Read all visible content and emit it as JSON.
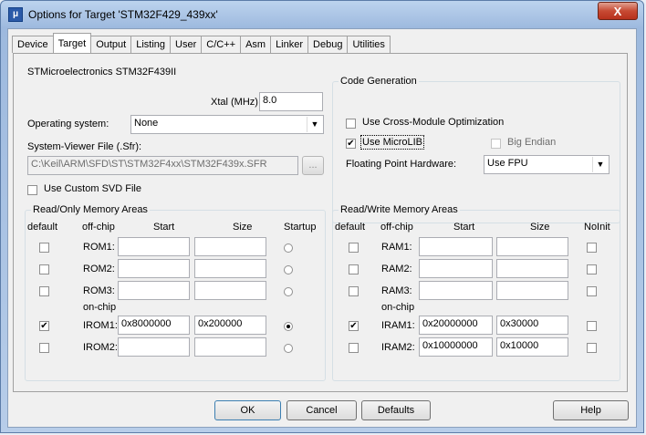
{
  "window": {
    "title": "Options for Target 'STM32F429_439xx'",
    "close_label": "X"
  },
  "tabs": [
    "Device",
    "Target",
    "Output",
    "Listing",
    "User",
    "C/C++",
    "Asm",
    "Linker",
    "Debug",
    "Utilities"
  ],
  "target": {
    "device_name": "STMicroelectronics STM32F439II",
    "xtal_label": "Xtal (MHz):",
    "xtal_value": "8.0",
    "os_label": "Operating system:",
    "os_value": "None",
    "svd_label": "System-Viewer File (.Sfr):",
    "svd_value": "C:\\Keil\\ARM\\SFD\\ST\\STM32F4xx\\STM32F439x.SFR",
    "browse_label": "...",
    "custom_svd_label": "Use Custom SVD File"
  },
  "code_generation": {
    "title": "Code Generation",
    "cross_module_label": "Use Cross-Module Optimization",
    "microlib_label": "Use MicroLIB",
    "microlib_checked": true,
    "big_endian_label": "Big Endian",
    "fpu_label": "Floating Point Hardware:",
    "fpu_value": "Use FPU"
  },
  "rom": {
    "title": "Read/Only Memory Areas",
    "headers": {
      "default": "default",
      "offchip": "off-chip",
      "start": "Start",
      "size": "Size",
      "extra": "Startup"
    },
    "onchip_label": "on-chip",
    "rows": [
      {
        "label": "ROM1:",
        "start": "",
        "size": "",
        "checked": false,
        "startup": false
      },
      {
        "label": "ROM2:",
        "start": "",
        "size": "",
        "checked": false,
        "startup": false
      },
      {
        "label": "ROM3:",
        "start": "",
        "size": "",
        "checked": false,
        "startup": false
      },
      {
        "label": "IROM1:",
        "start": "0x8000000",
        "size": "0x200000",
        "checked": true,
        "startup": true
      },
      {
        "label": "IROM2:",
        "start": "",
        "size": "",
        "checked": false,
        "startup": false
      }
    ]
  },
  "ram": {
    "title": "Read/Write Memory Areas",
    "headers": {
      "default": "default",
      "offchip": "off-chip",
      "start": "Start",
      "size": "Size",
      "extra": "NoInit"
    },
    "onchip_label": "on-chip",
    "rows": [
      {
        "label": "RAM1:",
        "start": "",
        "size": "",
        "checked": false,
        "noinit": false
      },
      {
        "label": "RAM2:",
        "start": "",
        "size": "",
        "checked": false,
        "noinit": false
      },
      {
        "label": "RAM3:",
        "start": "",
        "size": "",
        "checked": false,
        "noinit": false
      },
      {
        "label": "IRAM1:",
        "start": "0x20000000",
        "size": "0x30000",
        "checked": true,
        "noinit": false
      },
      {
        "label": "IRAM2:",
        "start": "0x10000000",
        "size": "0x10000",
        "checked": false,
        "noinit": false
      }
    ]
  },
  "buttons": {
    "ok": "OK",
    "cancel": "Cancel",
    "defaults": "Defaults",
    "help": "Help"
  }
}
